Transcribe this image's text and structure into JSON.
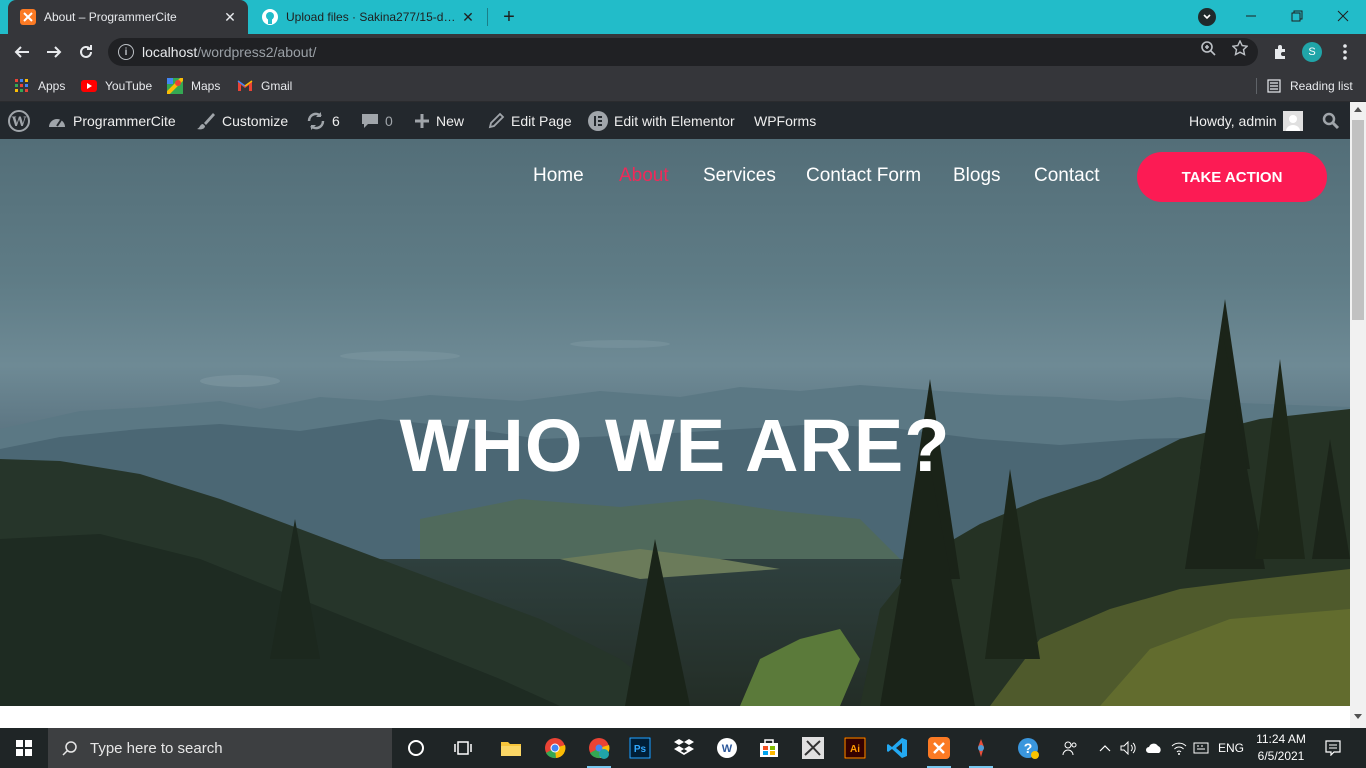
{
  "browser": {
    "tabs": [
      {
        "title": "About – ProgrammerCite",
        "active": true
      },
      {
        "title": "Upload files · Sakina277/15-days",
        "active": false
      }
    ],
    "address": {
      "host": "localhost",
      "path": "/wordpress2/about/"
    },
    "profile_initial": "S",
    "bookmarks": [
      {
        "label": "Apps",
        "icon": "apps-grid-icon"
      },
      {
        "label": "YouTube",
        "icon": "youtube-icon"
      },
      {
        "label": "Maps",
        "icon": "maps-icon"
      },
      {
        "label": "Gmail",
        "icon": "gmail-icon"
      }
    ],
    "reading_list": "Reading list"
  },
  "adminbar": {
    "site": "ProgrammerCite",
    "customize": "Customize",
    "updates": "6",
    "comments": "0",
    "new": "New",
    "edit_page": "Edit Page",
    "elementor": "Edit with Elementor",
    "wpforms": "WPForms",
    "howdy": "Howdy, admin"
  },
  "site": {
    "nav": [
      {
        "label": "Home",
        "active": false
      },
      {
        "label": "About",
        "active": true
      },
      {
        "label": "Services",
        "active": false
      },
      {
        "label": "Contact Form",
        "active": false
      },
      {
        "label": "Blogs",
        "active": false
      },
      {
        "label": "Contact",
        "active": false
      }
    ],
    "cta": "TAKE ACTION",
    "hero_title": "WHO WE ARE?"
  },
  "taskbar": {
    "search_placeholder": "Type here to search",
    "language": "ENG",
    "time": "11:24 AM",
    "date": "6/5/2021"
  },
  "colors": {
    "accent": "#fc1b54",
    "nav_active": "#ef2a59",
    "adminbar_bg": "#23282d",
    "tabstrip_bg": "#22bcc9"
  }
}
